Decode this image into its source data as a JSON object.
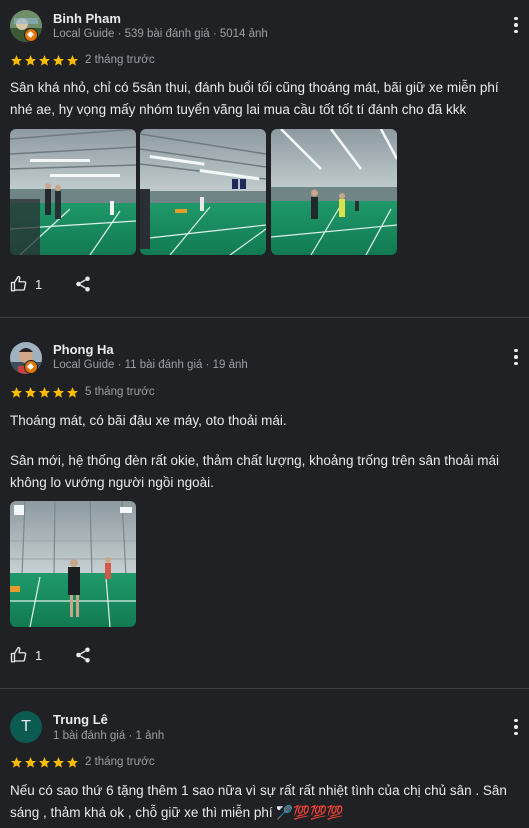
{
  "reviews": [
    {
      "author": "Binh Pham",
      "meta": "Local Guide · 539 bài đánh giá · 5014 ảnh",
      "rating": 5,
      "date": "2 tháng trước",
      "text": "Sân khá nhỏ, chỉ có 5sân thui, đánh buổi tối cũng thoáng mát, bãi giữ xe miễn phí nhé ae, hy vọng mấy nhóm tuyển vãng lai mua cầu tốt tốt tí đánh cho đã kkk",
      "likes": "1"
    },
    {
      "author": "Phong Ha",
      "meta": "Local Guide · 11 bài đánh giá · 19 ảnh",
      "rating": 5,
      "date": "5 tháng trước",
      "text_p1": "Thoáng mát, có bãi đậu xe máy, oto thoải mái.",
      "text_p2": "Sân mới, hệ thống đèn rất okie, thảm chất lượng, khoảng trống trên sân thoải mái không lo vướng người ngồi ngoài.",
      "likes": "1"
    },
    {
      "author": "Trung Lê",
      "avatar_letter": "T",
      "meta": "1 bài đánh giá · 1 ảnh",
      "rating": 5,
      "date": "2 tháng trước",
      "text": "Nếu có sao thứ 6 tặng thêm 1 sao nữa vì sự rất rất nhiệt tình của chị chủ sân . Sân sáng , thảm khá ok , chỗ giữ xe thì miễn phí 🏸💯💯💯"
    }
  ],
  "colors": {
    "background": "#202124",
    "star": "#fbbc04",
    "meta_text": "#9aa0a6",
    "divider": "#3c4043",
    "avatar_trung": "#0b5b53"
  },
  "icons": [
    "thumbs-up-icon",
    "share-icon",
    "more-vert-icon",
    "star-icon",
    "local-guide-badge-icon"
  ]
}
